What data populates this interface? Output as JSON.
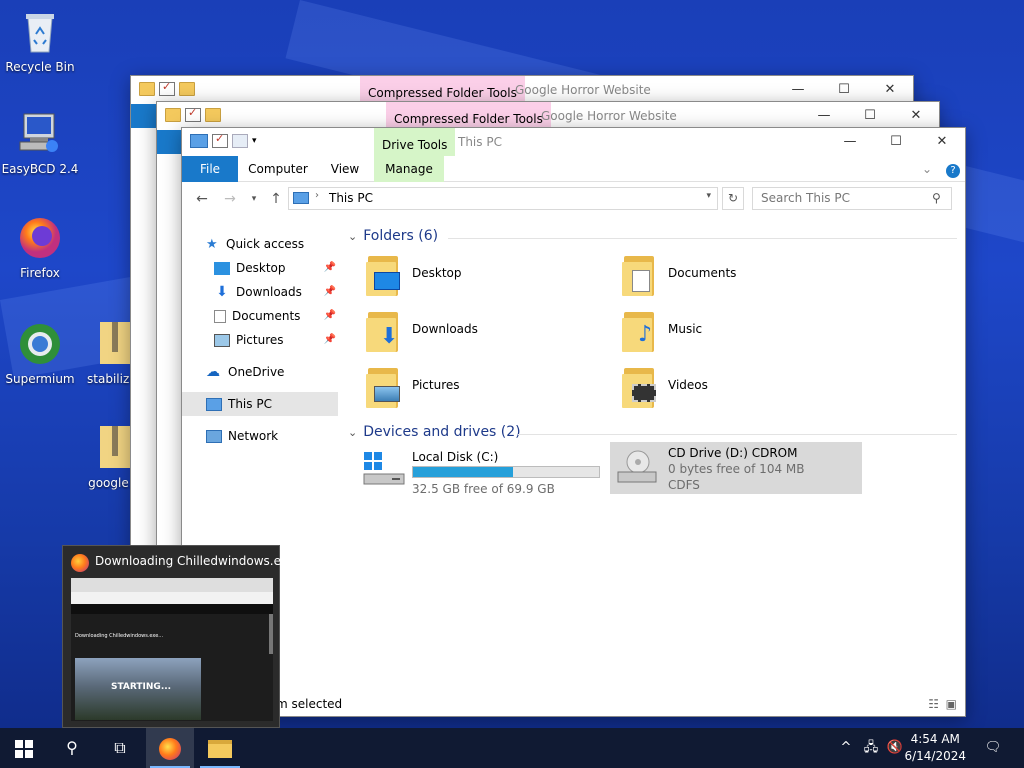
{
  "desktop": {
    "icons": [
      {
        "label": "Recycle Bin",
        "icon": "recycle-bin-icon"
      },
      {
        "label": "EasyBCD 2.4",
        "icon": "easybcd-icon"
      },
      {
        "label": "Firefox",
        "icon": "firefox-icon"
      },
      {
        "label": "Supermium",
        "icon": "supermium-icon"
      },
      {
        "label": "stabilize-",
        "icon": "zip-folder-icon"
      },
      {
        "label": "google.e",
        "icon": "zip-folder-icon"
      }
    ]
  },
  "back_windows": [
    {
      "context_tab": "Compressed Folder Tools",
      "title": "Google Horror Website"
    },
    {
      "context_tab": "Compressed Folder Tools",
      "title": "Google Horror Website"
    }
  ],
  "explorer": {
    "title": "This PC",
    "context_tab_group": "Drive Tools",
    "tabs": [
      "File",
      "Computer",
      "View",
      "Manage"
    ],
    "address": "This PC",
    "search_placeholder": "Search This PC",
    "nav": {
      "quick_access": "Quick access",
      "quick_items": [
        "Desktop",
        "Downloads",
        "Documents",
        "Pictures"
      ],
      "onedrive": "OneDrive",
      "this_pc": "This PC",
      "network": "Network"
    },
    "folders_header": "Folders (6)",
    "folders": [
      "Desktop",
      "Documents",
      "Downloads",
      "Music",
      "Pictures",
      "Videos"
    ],
    "drives_header": "Devices and drives (2)",
    "drives": [
      {
        "name": "Local Disk (C:)",
        "free": "32.5 GB free of 69.9 GB",
        "used_fraction": 0.535
      },
      {
        "name": "CD Drive (D:) CDROM",
        "free": "0 bytes free of 104 MB",
        "fs": "CDFS"
      }
    ],
    "status": "m selected"
  },
  "thumbnail": {
    "title": "Downloading Chilledwindows.e...",
    "page_heading": "Downloading Chilledwindows.exe...",
    "video_text": "STARTING..."
  },
  "taskbar": {
    "time": "4:54 AM",
    "date": "6/14/2024"
  },
  "colors": {
    "accent": "#1979ca",
    "selection": "#cce8ff",
    "compressed_tab": "#fbcfe8",
    "drive_tools_tab": "#d6f5c8",
    "progress": "#26a0da"
  }
}
